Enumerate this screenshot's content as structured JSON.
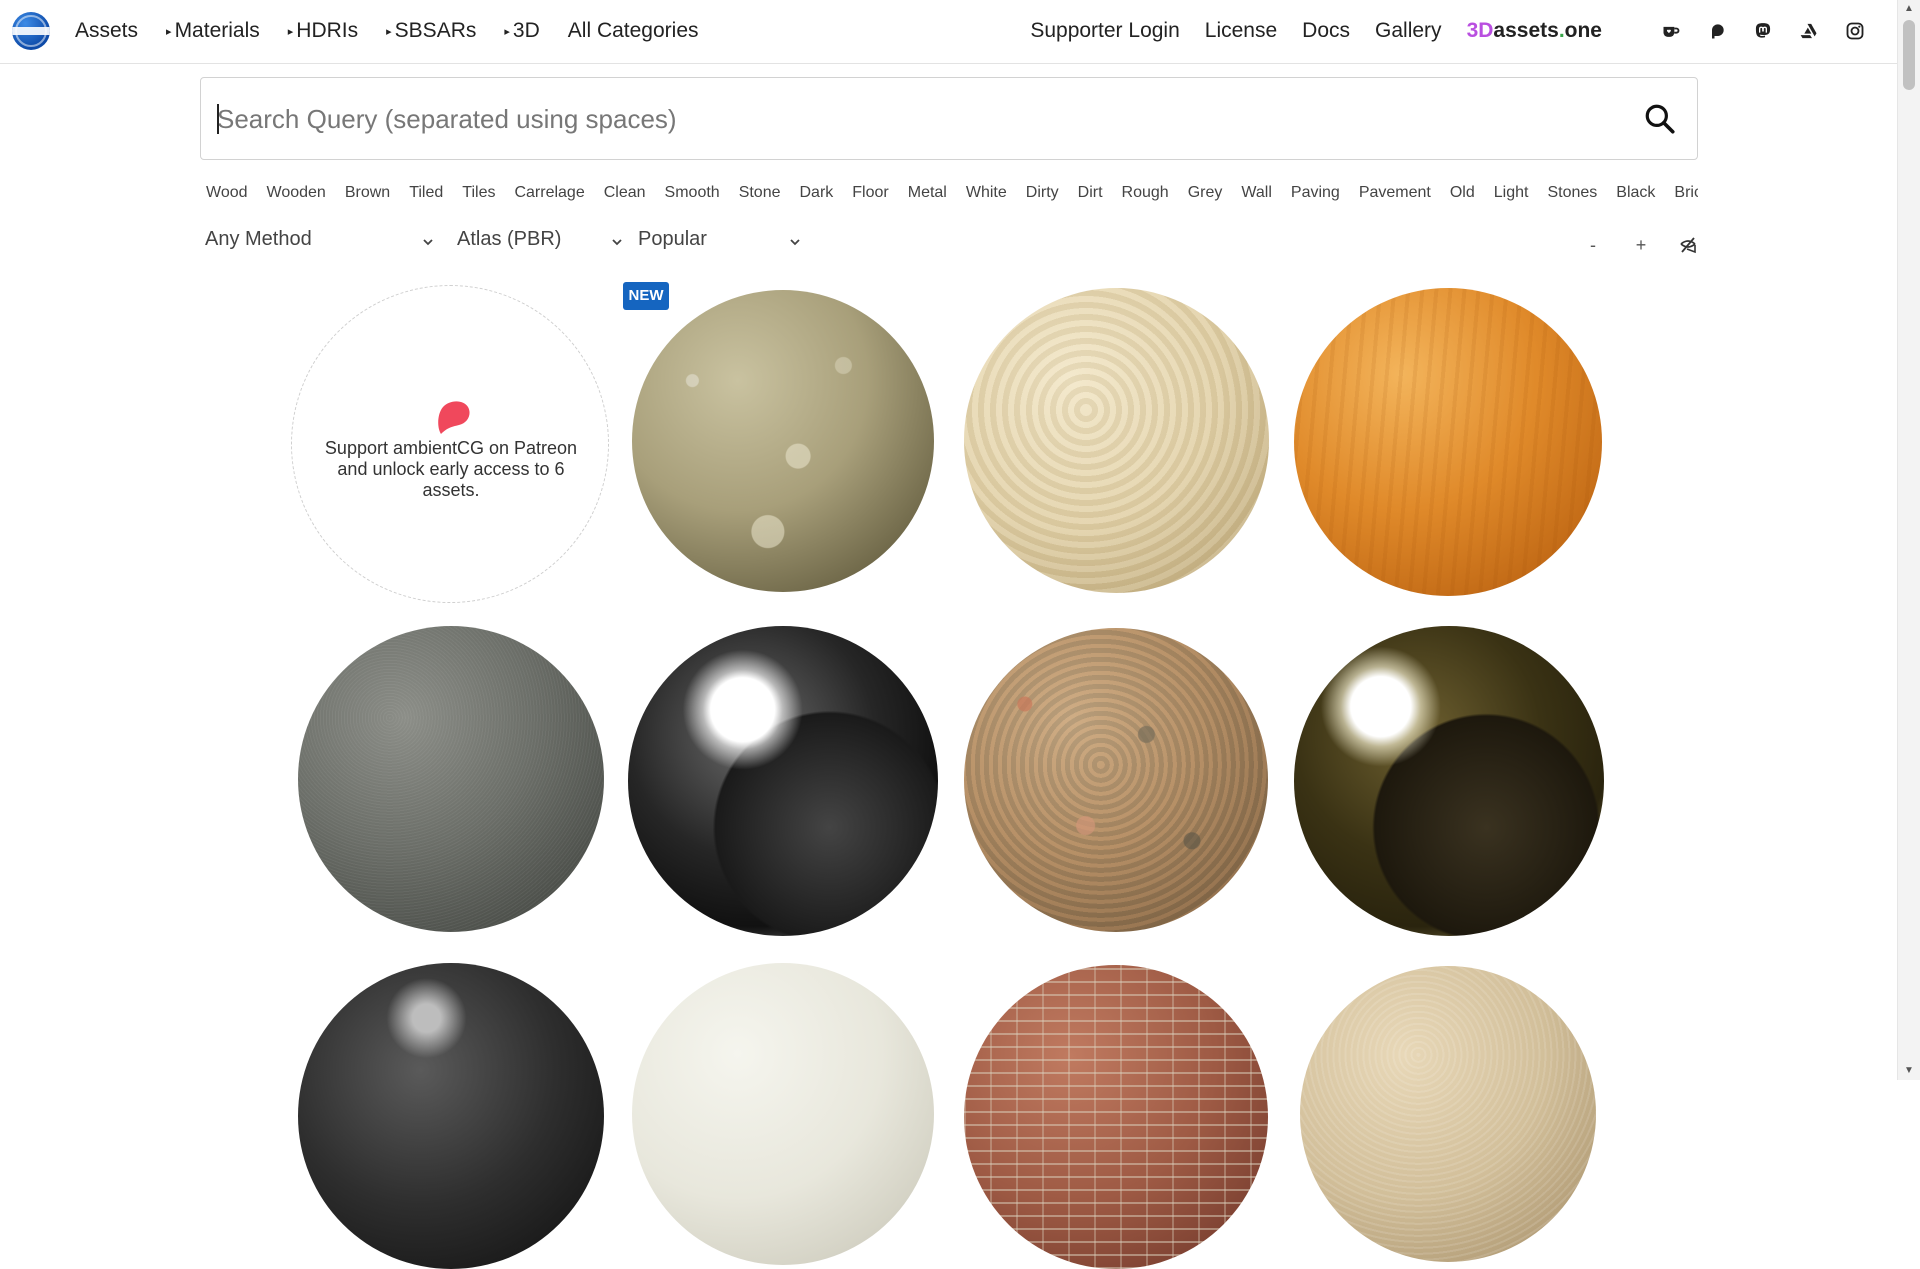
{
  "nav": {
    "assets": "Assets",
    "materials": "Materials",
    "hdris": "HDRIs",
    "sbsars": "SBSARs",
    "three_d": "3D",
    "all_categories": "All Categories",
    "supporter_login": "Supporter Login",
    "license": "License",
    "docs": "Docs",
    "gallery": "Gallery",
    "brand": {
      "part1": "3D",
      "part2": "assets",
      "part3": ".",
      "part4": "one"
    },
    "social_icons": [
      "ko-fi-icon",
      "patreon-icon",
      "mastodon-icon",
      "artstation-icon",
      "instagram-icon"
    ]
  },
  "search": {
    "placeholder": "Search Query (separated using spaces)"
  },
  "tags": [
    "Wood",
    "Wooden",
    "Brown",
    "Tiled",
    "Tiles",
    "Carrelage",
    "Clean",
    "Smooth",
    "Stone",
    "Dark",
    "Floor",
    "Metal",
    "White",
    "Dirty",
    "Dirt",
    "Rough",
    "Grey",
    "Wall",
    "Paving",
    "Pavement",
    "Old",
    "Light",
    "Stones",
    "Black",
    "Bricks"
  ],
  "filters": {
    "method": "Any Method",
    "type": "Atlas (PBR)",
    "sort": "Popular"
  },
  "zoom": {
    "minus": "-",
    "plus": "+"
  },
  "patreon_card": {
    "text": "Support ambientCG on Patreon and unlock early access to 6 assets."
  },
  "badges": {
    "new": "NEW"
  },
  "colors": {
    "accent": "#1565c0",
    "patreon": "#f0485c",
    "brand_purple": "#b94fe0",
    "brand_green": "#3aa64a"
  }
}
